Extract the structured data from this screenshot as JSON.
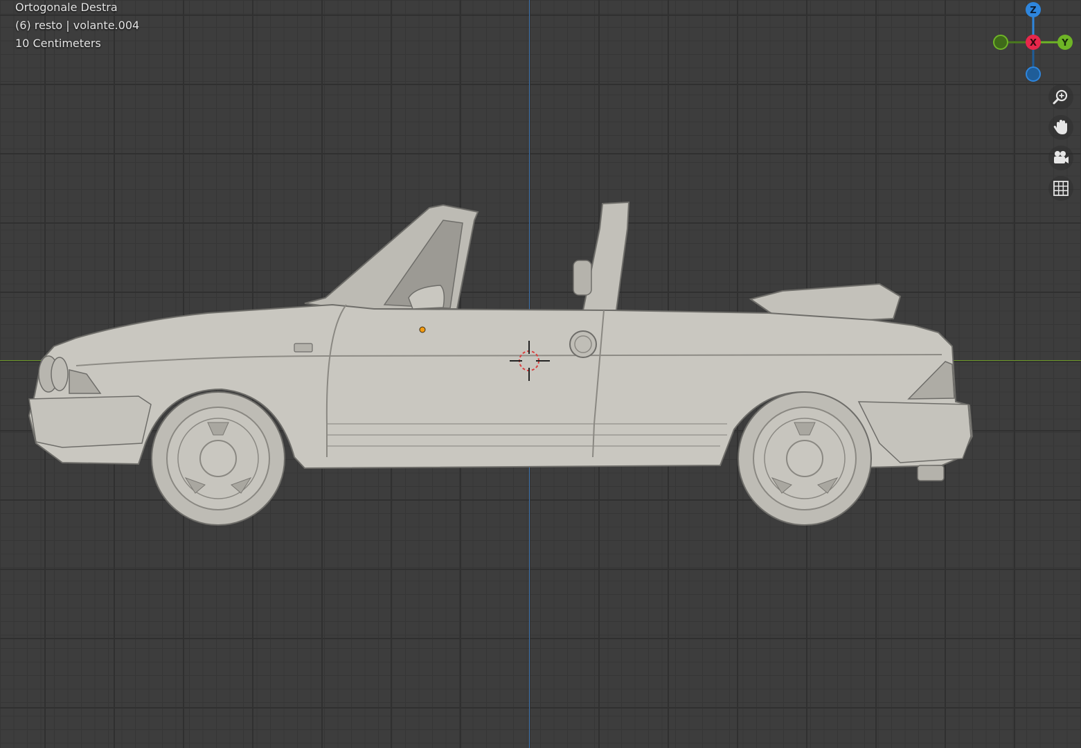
{
  "viewport": {
    "view_name": "Ortogonale Destra",
    "object_info": "(6) resto | volante.004",
    "grid_scale": "10 Centimeters"
  },
  "gizmo": {
    "z_label": "Z",
    "x_label": "X",
    "y_label": "Y",
    "colors": {
      "x": "#e8274b",
      "y": "#6eb526",
      "z": "#2e86de"
    }
  },
  "nav_buttons": [
    {
      "name": "zoom",
      "icon": "zoom-icon"
    },
    {
      "name": "pan",
      "icon": "hand-icon"
    },
    {
      "name": "camera",
      "icon": "camera-icon"
    },
    {
      "name": "perspective",
      "icon": "grid-icon"
    }
  ],
  "colors": {
    "background": "#3d3d3d",
    "model": "#c9c7c0",
    "x_axis_line": "#6f9a2a",
    "z_axis_line": "#3e74b0",
    "origin": "#f39c12"
  }
}
